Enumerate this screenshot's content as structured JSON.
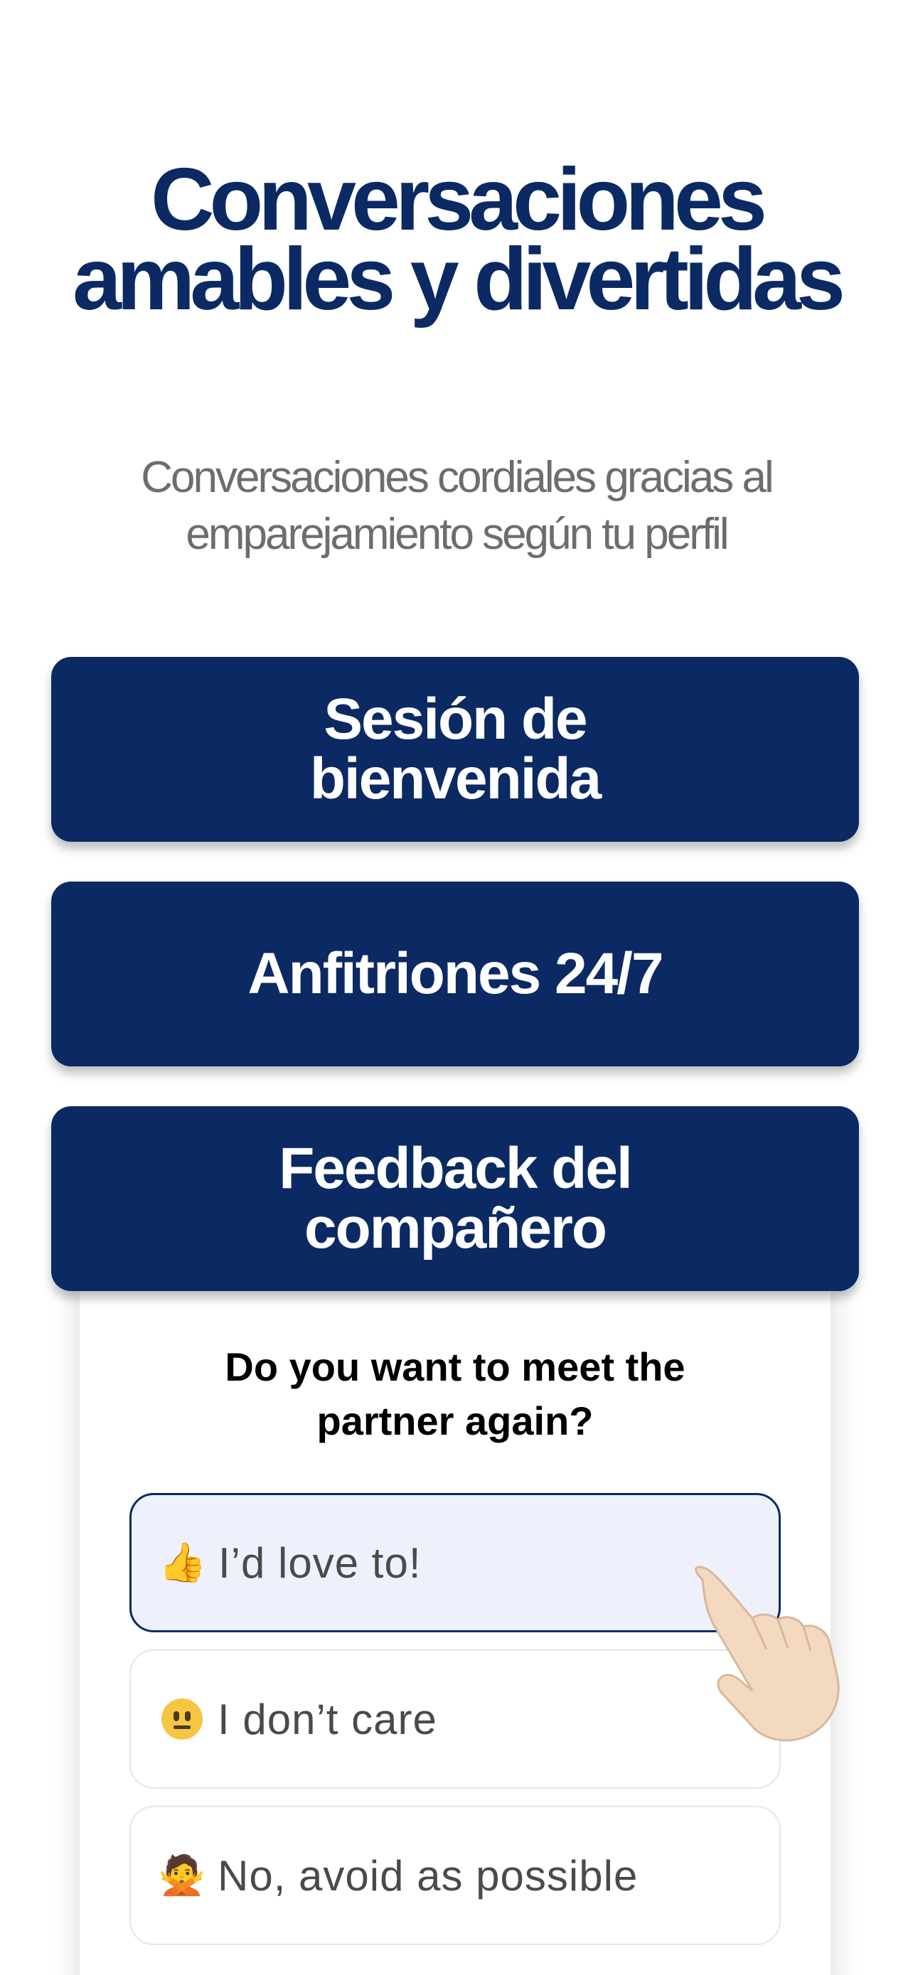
{
  "headline": {
    "line1": "Conversaciones",
    "line2": "amables y divertidas"
  },
  "subheadline": {
    "line1": "Conversaciones cordiales gracias al",
    "line2": "emparejamiento según tu perfil"
  },
  "features": {
    "welcome_session": "Sesión de bienvenida",
    "hosts": "Anfitriones 24/7",
    "partner_feedback": "Feedback del compañero"
  },
  "survey": {
    "question": "Do you want to meet the partner again?",
    "options": [
      {
        "emoji": "thumbs-up-icon",
        "label": "I’d love to!",
        "selected": true
      },
      {
        "emoji": "neutral-face-icon",
        "label": "I don’t care",
        "selected": false
      },
      {
        "emoji": "person-gesturing-no-icon",
        "label": "No, avoid as possible",
        "selected": false
      }
    ]
  },
  "colors": {
    "primary": "#0b2a63",
    "subtext": "#6d6d6d",
    "selected_bg": "#eef1fb",
    "option_border": "#e6e6e6"
  }
}
